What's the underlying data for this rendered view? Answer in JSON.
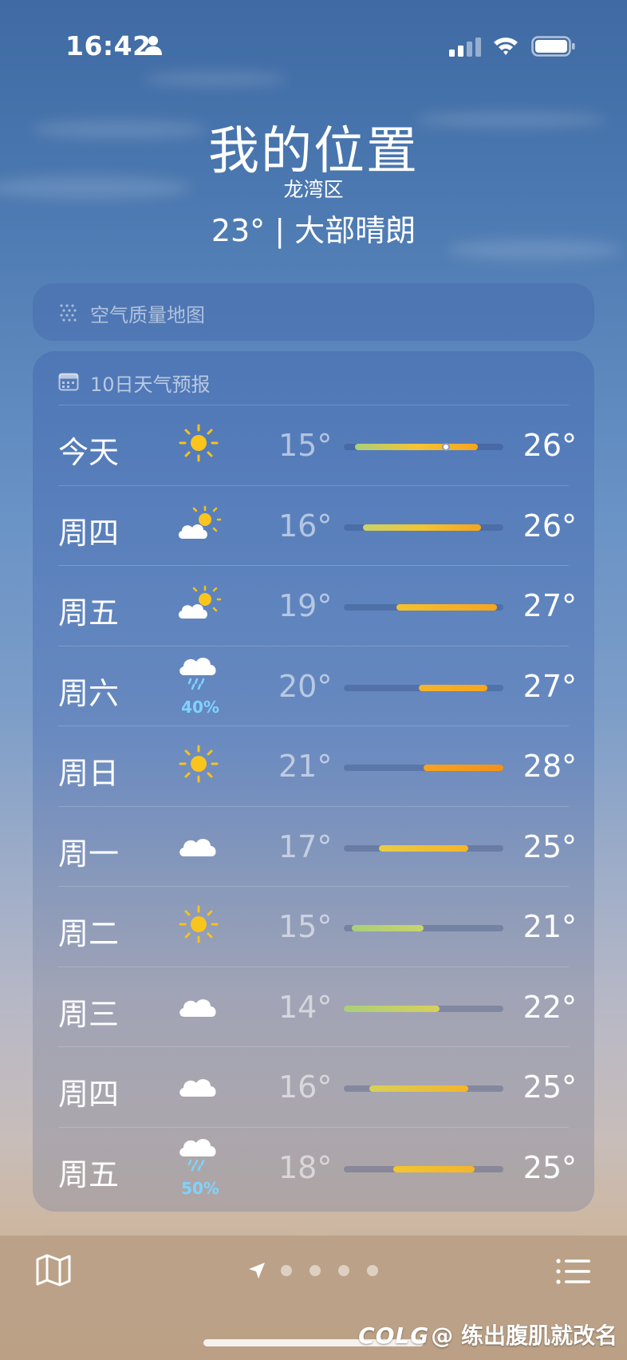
{
  "status_bar": {
    "time": "16:42",
    "icons": [
      "person-icon",
      "cellular-signal-icon",
      "wifi-icon",
      "battery-icon"
    ]
  },
  "header": {
    "title": "我的位置",
    "subtitle": "龙湾区",
    "current": "23° | 大部晴朗"
  },
  "air_quality": {
    "icon": "air-quality-dots-icon",
    "label": "空气质量地图"
  },
  "forecast": {
    "icon": "calendar-icon",
    "label": "10日天气预报",
    "days": [
      {
        "day": "今天",
        "icon": "sun-icon",
        "precip": "",
        "low": "15°",
        "high": "26°",
        "bar": [
          0.07,
          0.84
        ],
        "current_marker": 0.64,
        "colors": [
          "#a9cf7c",
          "#f4c534",
          "#f6a41e"
        ]
      },
      {
        "day": "周四",
        "icon": "partly-cloudy-icon",
        "precip": "",
        "low": "16°",
        "high": "26°",
        "bar": [
          0.12,
          0.86
        ],
        "current_marker": null,
        "colors": [
          "#c9d36a",
          "#f2c531",
          "#f6a41e"
        ]
      },
      {
        "day": "周五",
        "icon": "partly-cloudy-icon",
        "precip": "",
        "low": "19°",
        "high": "27°",
        "bar": [
          0.33,
          0.96
        ],
        "current_marker": null,
        "colors": [
          "#f3c22f",
          "#f6a41e"
        ]
      },
      {
        "day": "周六",
        "icon": "cloud-rain-icon",
        "precip": "40%",
        "low": "20°",
        "high": "27°",
        "bar": [
          0.47,
          0.9
        ],
        "current_marker": null,
        "colors": [
          "#f4b52a",
          "#f6a41e"
        ]
      },
      {
        "day": "周日",
        "icon": "sun-icon",
        "precip": "",
        "low": "21°",
        "high": "28°",
        "bar": [
          0.5,
          1.0
        ],
        "current_marker": null,
        "colors": [
          "#f6a41e",
          "#f39119"
        ]
      },
      {
        "day": "周一",
        "icon": "cloud-icon",
        "precip": "",
        "low": "17°",
        "high": "25°",
        "bar": [
          0.22,
          0.78
        ],
        "current_marker": null,
        "colors": [
          "#e8cc45",
          "#f4b52a"
        ]
      },
      {
        "day": "周二",
        "icon": "sun-icon",
        "precip": "",
        "low": "15°",
        "high": "21°",
        "bar": [
          0.05,
          0.5
        ],
        "current_marker": null,
        "colors": [
          "#a9cf7c",
          "#c9d36a"
        ]
      },
      {
        "day": "周三",
        "icon": "cloud-icon",
        "precip": "",
        "low": "14°",
        "high": "22°",
        "bar": [
          0.0,
          0.6
        ],
        "current_marker": null,
        "colors": [
          "#a9cf7c",
          "#d8d05a"
        ]
      },
      {
        "day": "周四",
        "icon": "cloud-icon",
        "precip": "",
        "low": "16°",
        "high": "25°",
        "bar": [
          0.16,
          0.78
        ],
        "current_marker": null,
        "colors": [
          "#d8d05a",
          "#f4b52a"
        ]
      },
      {
        "day": "周五",
        "icon": "cloud-rain-icon",
        "precip": "50%",
        "low": "18°",
        "high": "25°",
        "bar": [
          0.31,
          0.82
        ],
        "current_marker": null,
        "colors": [
          "#f2c531",
          "#f4b52a"
        ]
      }
    ]
  },
  "toolbar": {
    "left_icon": "map-icon",
    "right_icon": "list-icon",
    "page_indicator": {
      "current_icon": "location-arrow-icon",
      "dots": 4
    }
  },
  "watermark": "@ 练出腹肌就改名",
  "watermark_logo": "COLG"
}
